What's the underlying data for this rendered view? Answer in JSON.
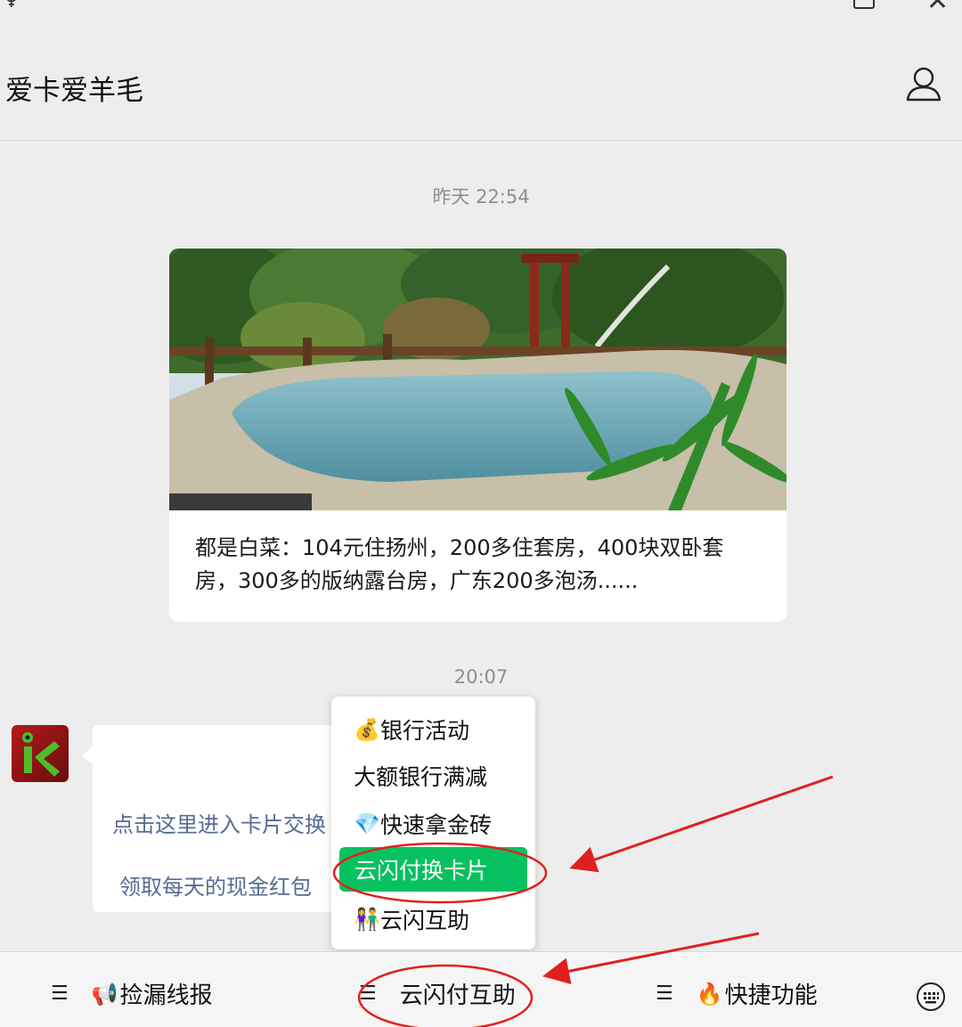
{
  "header": {
    "title": "爱卡爱羊毛"
  },
  "chat": {
    "timestamp_1": "昨天 22:54",
    "article_text": "都是白菜：104元住扬州，200多住套房，400块双卧套房，300多的版纳露台房，广东200多泡汤......",
    "timestamp_2": "20:07",
    "bubble_link_1": "点击这里进入卡片交换",
    "bubble_link_2": "领取每天的现金红包"
  },
  "popup_menu": {
    "items": [
      {
        "emoji": "💰",
        "label": "银行活动"
      },
      {
        "emoji": "",
        "label": "大额银行满减"
      },
      {
        "emoji": "💎",
        "label": "快速拿金砖"
      },
      {
        "emoji": "",
        "label": "云闪付换卡片"
      },
      {
        "emoji": "👫",
        "label": "云闪互助"
      }
    ]
  },
  "bottom_menu": {
    "items": [
      {
        "emoji": "📢",
        "label": "捡漏线报"
      },
      {
        "emoji": "",
        "label": "云闪付互助"
      },
      {
        "emoji": "🔥",
        "label": "快捷功能"
      }
    ]
  },
  "colors": {
    "accent_green": "#07c160",
    "link_blue": "#576b95",
    "annotation_red": "#e02020"
  }
}
